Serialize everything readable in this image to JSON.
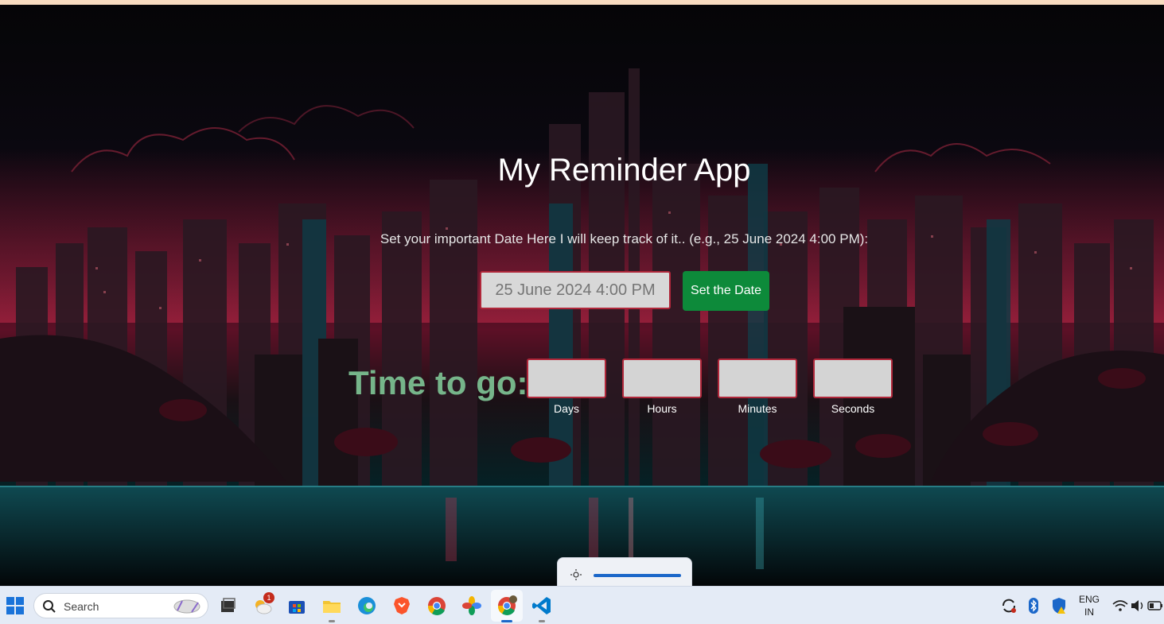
{
  "app": {
    "title": "My Reminder App",
    "subtitle": "Set your important Date Here I will keep track of it.. (e.g., 25 June 2024 4:00 PM):",
    "date_placeholder": "25 June 2024 4:00 PM",
    "set_button": "Set the Date",
    "countdown_title": "Time to go:",
    "units": [
      "Days",
      "Hours",
      "Minutes",
      "Seconds"
    ],
    "colors": {
      "button": "#0d8a3a",
      "countdown_title": "#76b58a",
      "box_border": "#b0273a"
    }
  },
  "brightness": {
    "icon": "sun-icon",
    "level": 1.0
  },
  "taskbar": {
    "search_label": "Search",
    "apps": [
      "windows-start-icon",
      "search-icon",
      "task-view-icon",
      "weather-icon",
      "store-icon",
      "file-explorer-icon",
      "edge-icon",
      "brave-icon",
      "chrome-icon",
      "photos-icon",
      "chrome-active-icon",
      "vscode-icon"
    ],
    "weather_badge": "1",
    "tray": {
      "lang_line1": "ENG",
      "lang_line2": "IN"
    }
  }
}
